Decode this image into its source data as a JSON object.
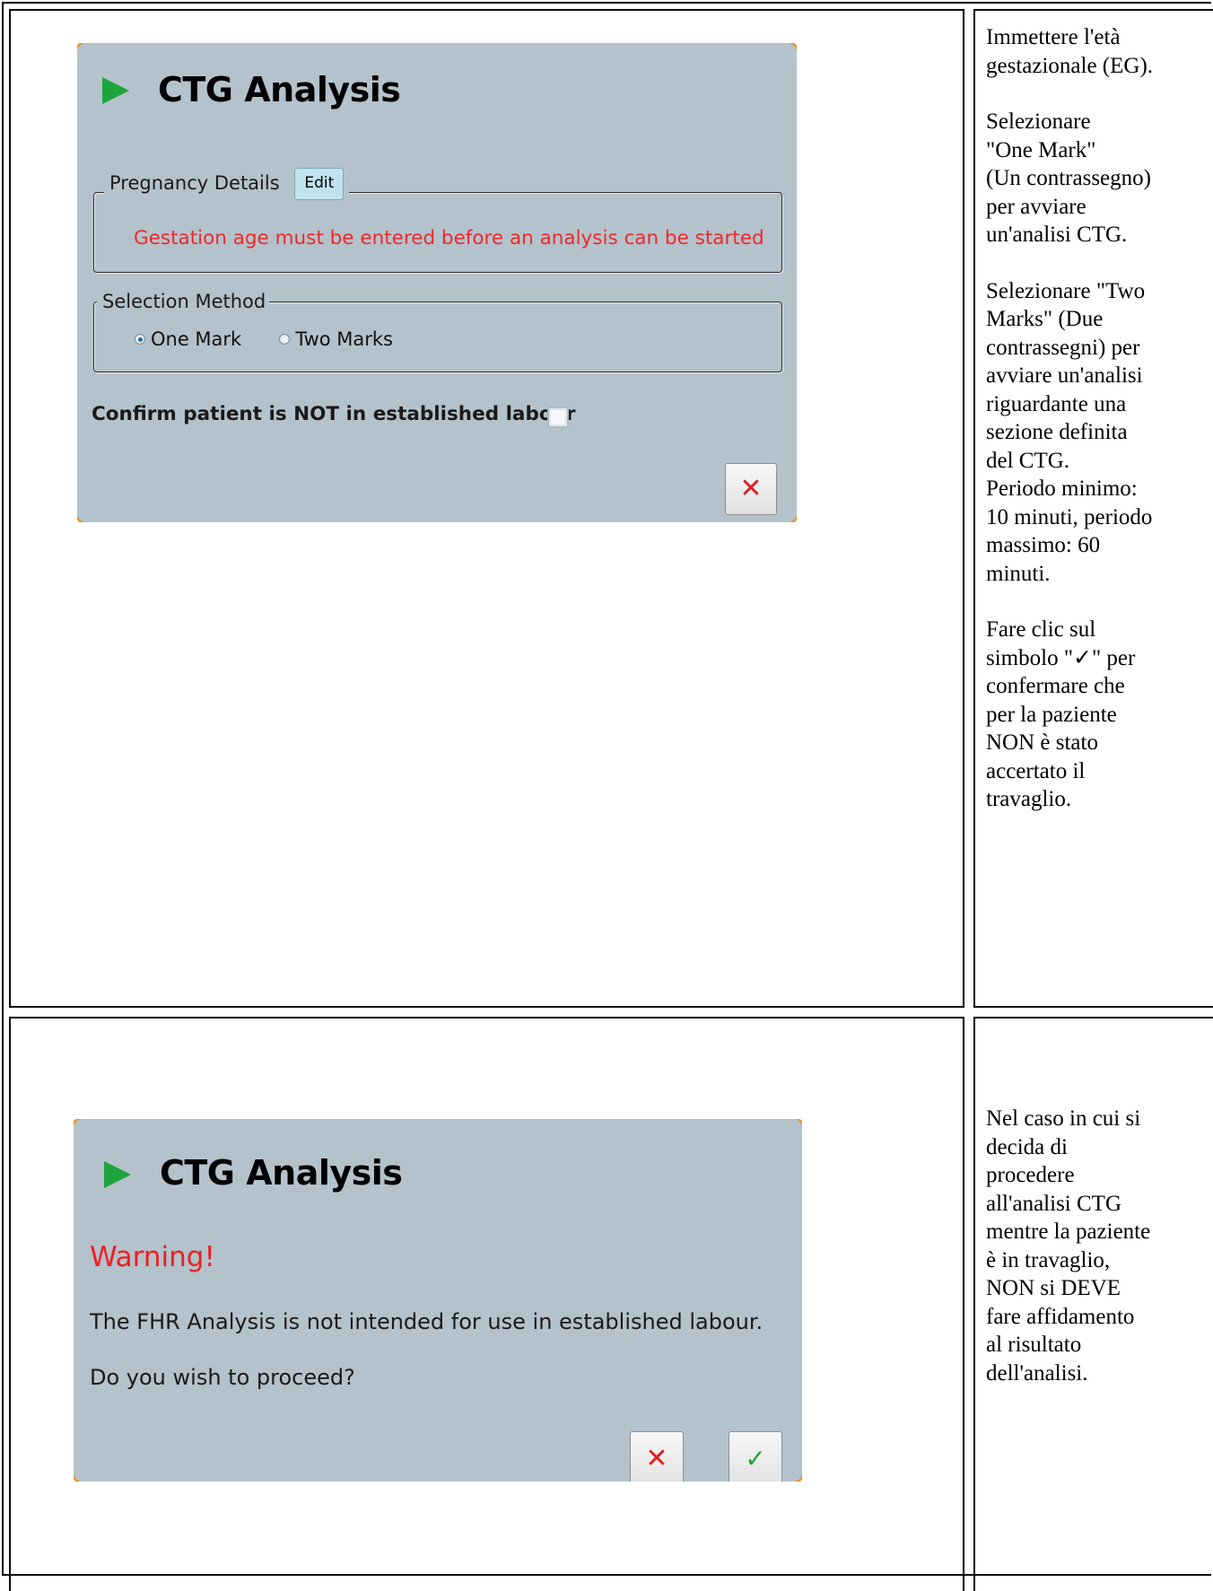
{
  "row1": {
    "dialog": {
      "title": "CTG Analysis",
      "pregnancy_details": {
        "legend": "Pregnancy Details",
        "edit_label": "Edit",
        "message": "Gestation age must be entered before an analysis can be started"
      },
      "selection_method": {
        "legend": "Selection Method",
        "options": [
          {
            "label": "One Mark",
            "selected": true
          },
          {
            "label": "Two Marks",
            "selected": false
          }
        ]
      },
      "confirm_label": "Confirm patient is NOT in established labour",
      "confirm_checked": false,
      "cancel_icon": "close-x-icon"
    },
    "instructions": [
      "Immettere l'età\ngestazionale (EG).",
      "Selezionare\n\"One Mark\"\n(Un contrassegno)\nper avviare\nun'analisi CTG.",
      "Selezionare \"Two\nMarks\" (Due\ncontrassegni) per\navviare un'analisi\nriguardante una\nsezione definita\ndel CTG.\nPeriodo minimo:\n10 minuti, periodo\nmassimo: 60\nminuti.",
      "Fare clic sul\nsimbolo \"✓\" per\nconfermare che\nper la paziente\nNON è stato\naccertato il\ntravaglio."
    ]
  },
  "row2": {
    "dialog": {
      "title": "CTG Analysis",
      "warning_title": "Warning!",
      "warning_text": "The FHR Analysis is not intended for use in established labour.",
      "question": "Do you wish to proceed?",
      "cancel_icon": "close-x-icon",
      "confirm_icon": "checkmark-icon"
    },
    "instructions": [
      "Nel caso in cui si\ndecida di\nprocedere\nall'analisi CTG\nmentre la paziente\nè in travaglio,\nNON si DEVE\nfare affidamento\nal risultato\ndell'analisi."
    ]
  },
  "colors": {
    "dialog_bg": "#b4c2cc",
    "accent_orange": "#f0901c",
    "play_green": "#1ea43c",
    "error_red": "#ec2a2a",
    "check_green": "#22a030"
  }
}
